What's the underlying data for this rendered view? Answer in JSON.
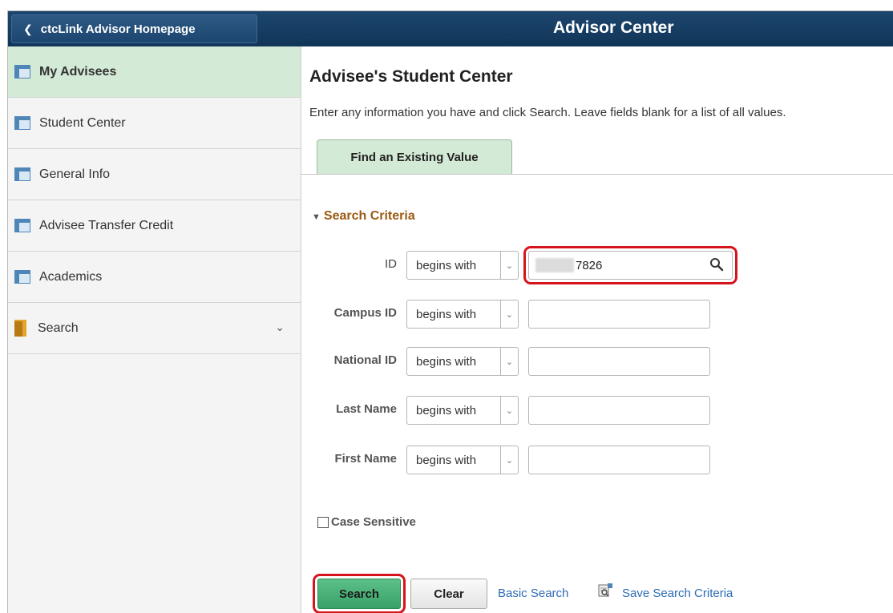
{
  "header": {
    "back_label": "ctcLink Advisor Homepage",
    "title": "Advisor Center"
  },
  "sidebar": {
    "items": [
      {
        "label": "My Advisees",
        "icon": "grid-page-icon",
        "active": true
      },
      {
        "label": "Student Center",
        "icon": "grid-page-icon"
      },
      {
        "label": "General Info",
        "icon": "grid-page-icon"
      },
      {
        "label": "Advisee Transfer Credit",
        "icon": "grid-page-icon"
      },
      {
        "label": "Academics",
        "icon": "grid-page-icon"
      },
      {
        "label": "Search",
        "icon": "folder-icon",
        "expandable": true
      }
    ]
  },
  "main": {
    "title": "Advisee's Student Center",
    "instructions": "Enter any information you have and click Search. Leave fields blank for a list of all values.",
    "tab_label": "Find an Existing Value",
    "section_label": "Search Criteria",
    "fields": [
      {
        "label": "ID",
        "operator": "begins with",
        "value": "7826"
      },
      {
        "label": "Campus ID",
        "operator": "begins with",
        "value": ""
      },
      {
        "label": "National ID",
        "operator": "begins with",
        "value": ""
      },
      {
        "label": "Last Name",
        "operator": "begins with",
        "value": ""
      },
      {
        "label": "First Name",
        "operator": "begins with",
        "value": ""
      }
    ],
    "case_sensitive_label": "Case Sensitive",
    "search_button": "Search",
    "clear_button": "Clear",
    "basic_search_link": "Basic Search",
    "save_search_link": "Save Search Criteria"
  },
  "colors": {
    "header_bg": "#14395f",
    "active_nav_bg": "#d3ead6",
    "section_color": "#9c5a12",
    "link_color": "#2d6bb5",
    "search_button_bg": "#4bb078",
    "highlight_border": "#d6141b"
  }
}
